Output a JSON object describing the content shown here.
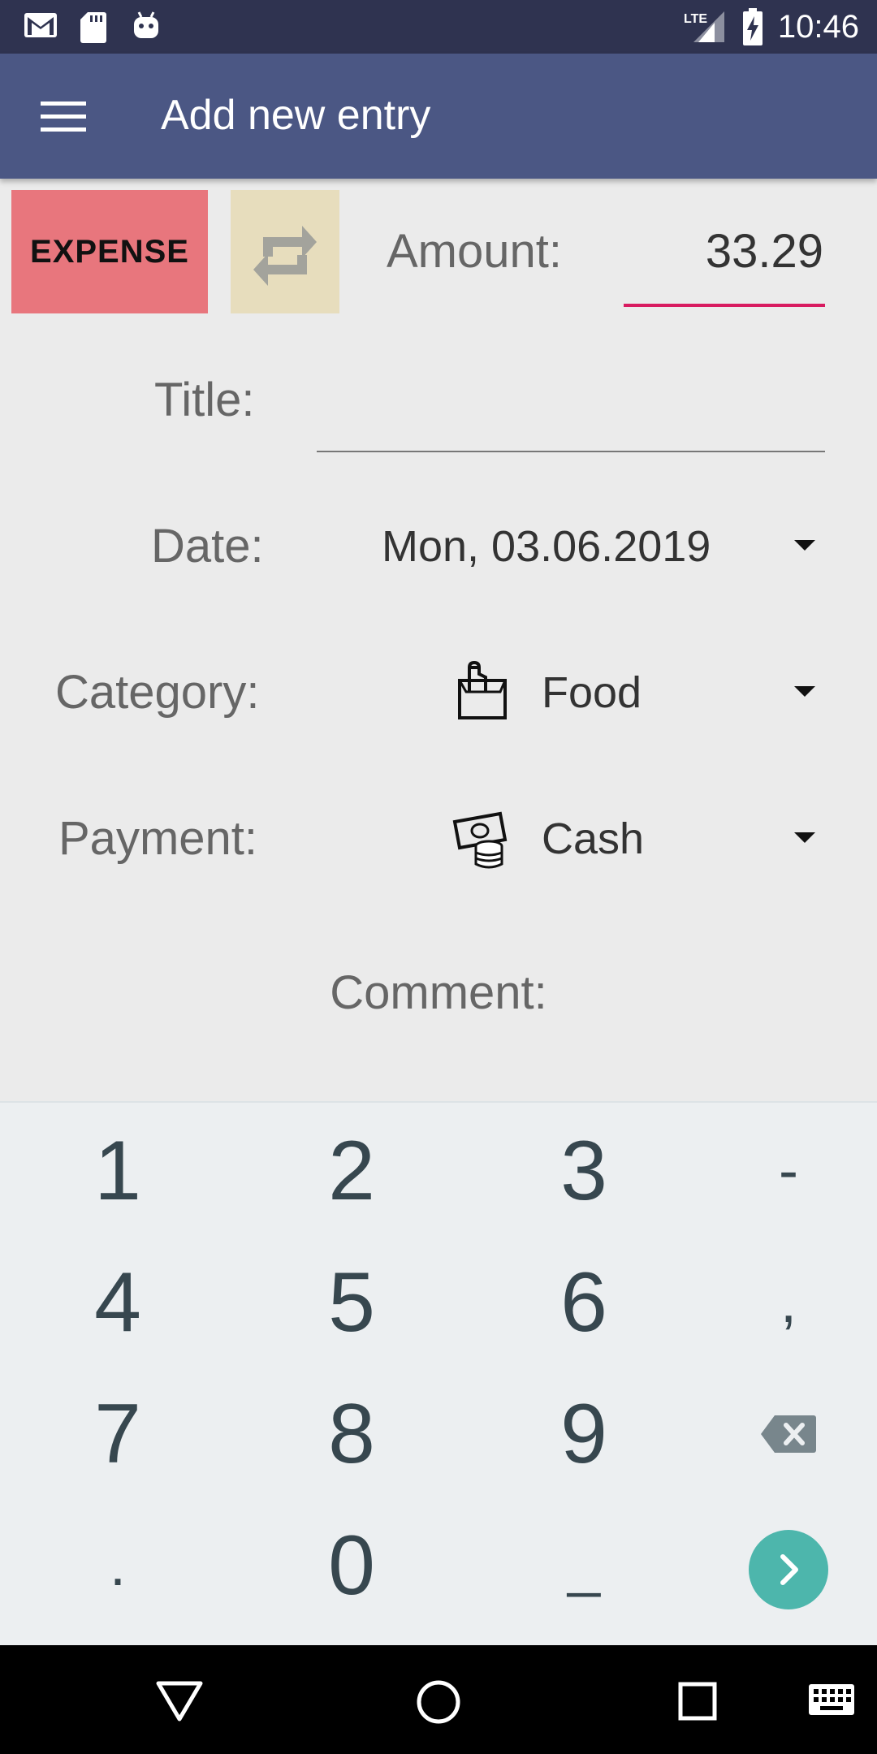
{
  "status_bar": {
    "time": "10:46",
    "network": "LTE",
    "left_icons": [
      "gmail-icon",
      "sd-card-icon",
      "android-icon"
    ],
    "right_icons": [
      "lte-signal-icon",
      "battery-charging-icon"
    ]
  },
  "toolbar": {
    "title": "Add new entry",
    "menu_icon": "hamburger-menu-icon"
  },
  "form": {
    "type_button": "EXPENSE",
    "swap_icon": "swap-arrows-icon",
    "amount_label": "Amount:",
    "amount_value": "33.29",
    "title_label": "Title:",
    "title_value": "",
    "date_label": "Date:",
    "date_value": "Mon, 03.06.2019",
    "category_label": "Category:",
    "category_value": "Food",
    "category_icon": "grocery-bag-icon",
    "payment_label": "Payment:",
    "payment_value": "Cash",
    "payment_icon": "cash-coins-icon",
    "comment_label": "Comment:"
  },
  "keypad": {
    "keys": [
      "1",
      "2",
      "3",
      "-",
      "4",
      "5",
      "6",
      ",",
      "7",
      "8",
      "9",
      "⌫",
      ".",
      "0",
      "_",
      ">"
    ],
    "backspace_icon": "backspace-icon",
    "go_icon": "chevron-right-icon"
  },
  "nav_bar": {
    "icons": [
      "back-triangle-icon",
      "home-circle-icon",
      "recents-square-icon",
      "keyboard-icon"
    ]
  },
  "colors": {
    "status_bar": "#2f3350",
    "toolbar": "#4b5784",
    "expense_button": "#e8767d",
    "swap_button": "#e7ddbd",
    "accent_underline": "#d81b60",
    "keypad_bg": "#eceff1",
    "key_text": "#37474f",
    "go_button": "#4db6ac"
  }
}
